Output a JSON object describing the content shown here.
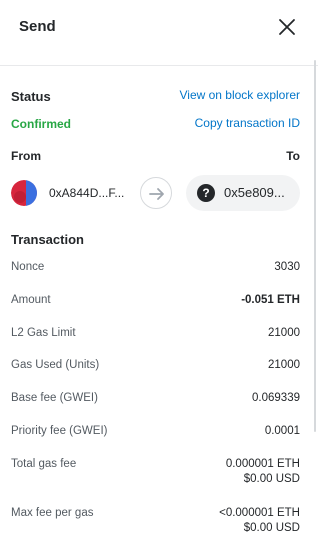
{
  "header": {
    "title": "Send"
  },
  "status": {
    "label": "Status",
    "value": "Confirmed",
    "view_explorer": "View on block explorer",
    "copy_tx": "Copy transaction ID"
  },
  "parties": {
    "from_label": "From",
    "to_label": "To",
    "from_address": "0xA844D...F...",
    "to_address": "0x5e809...",
    "to_icon_glyph": "?"
  },
  "transaction": {
    "title": "Transaction",
    "rows": [
      {
        "label": "Nonce",
        "value": "3030"
      },
      {
        "label": "Amount",
        "value": "-0.051 ETH"
      },
      {
        "label": "L2 Gas Limit",
        "value": "21000"
      },
      {
        "label": "Gas Used (Units)",
        "value": "21000"
      },
      {
        "label": "Base fee (GWEI)",
        "value": "0.069339"
      },
      {
        "label": "Priority fee (GWEI)",
        "value": "0.0001"
      },
      {
        "label": "Total gas fee",
        "value": "0.000001 ETH",
        "value2": "$0.00 USD"
      },
      {
        "label": "Max fee per gas",
        "value": "<0.000001 ETH",
        "value2": "$0.00 USD"
      }
    ]
  },
  "colors": {
    "confirmed": "#28a745",
    "link": "#0376c9",
    "text": "#24272a",
    "muted": "#535a61"
  },
  "icons": {
    "close": "close-icon",
    "arrow": "arrow-right-icon",
    "avatar": "account-avatar",
    "unknown": "question-icon"
  }
}
